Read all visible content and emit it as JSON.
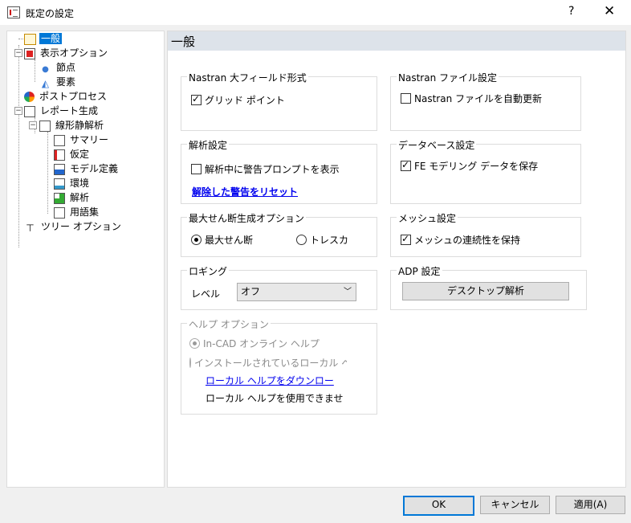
{
  "window": {
    "title": "既定の設定",
    "help": "?",
    "close": "✕"
  },
  "tree": {
    "items": [
      {
        "label": "一般"
      },
      {
        "label": "表示オプション"
      },
      {
        "label": "節点"
      },
      {
        "label": "要素"
      },
      {
        "label": "ポストプロセス"
      },
      {
        "label": "レポート生成"
      },
      {
        "label": "線形静解析"
      },
      {
        "label": "サマリー"
      },
      {
        "label": "仮定"
      },
      {
        "label": "モデル定義"
      },
      {
        "label": "環境"
      },
      {
        "label": "解析"
      },
      {
        "label": "用語集"
      },
      {
        "label": "ツリー オプション"
      }
    ]
  },
  "panel": {
    "title": "一般"
  },
  "nastran_large": {
    "title": "Nastran 大フィールド形式",
    "grid_point": "グリッド ポイント",
    "grid_point_checked": true
  },
  "nastran_file": {
    "title": "Nastran ファイル設定",
    "auto_update": "Nastran ファイルを自動更新",
    "auto_update_checked": false
  },
  "analysis": {
    "title": "解析設定",
    "show_warning": "解析中に警告プロンプトを表示",
    "show_warning_checked": false,
    "reset_link": "解除した警告をリセット"
  },
  "database": {
    "title": "データベース設定",
    "save_fe": "FE モデリング データを保存",
    "save_fe_checked": true
  },
  "shear": {
    "title": "最大せん断生成オプション",
    "max_shear": "最大せん断",
    "tresca": "トレスカ",
    "selected": "max_shear"
  },
  "mesh": {
    "title": "メッシュ設定",
    "keep_continuity": "メッシュの連続性を保持",
    "keep_continuity_checked": true
  },
  "logging": {
    "title": "ロギング",
    "level_label": "レベル",
    "level_value": "オフ"
  },
  "adp": {
    "title": "ADP 設定",
    "desktop_analysis": "デスクトップ解析"
  },
  "help": {
    "title": "ヘルプ オプション",
    "incad": "In-CAD オンライン ヘルプ",
    "local": "インストールされているローカル ヘルプ",
    "download_link": "ローカル ヘルプをダウンロー",
    "unavailable": "ローカル ヘルプを使用できませ"
  },
  "buttons": {
    "ok": "OK",
    "cancel": "キャンセル",
    "apply": "適用(A)"
  }
}
